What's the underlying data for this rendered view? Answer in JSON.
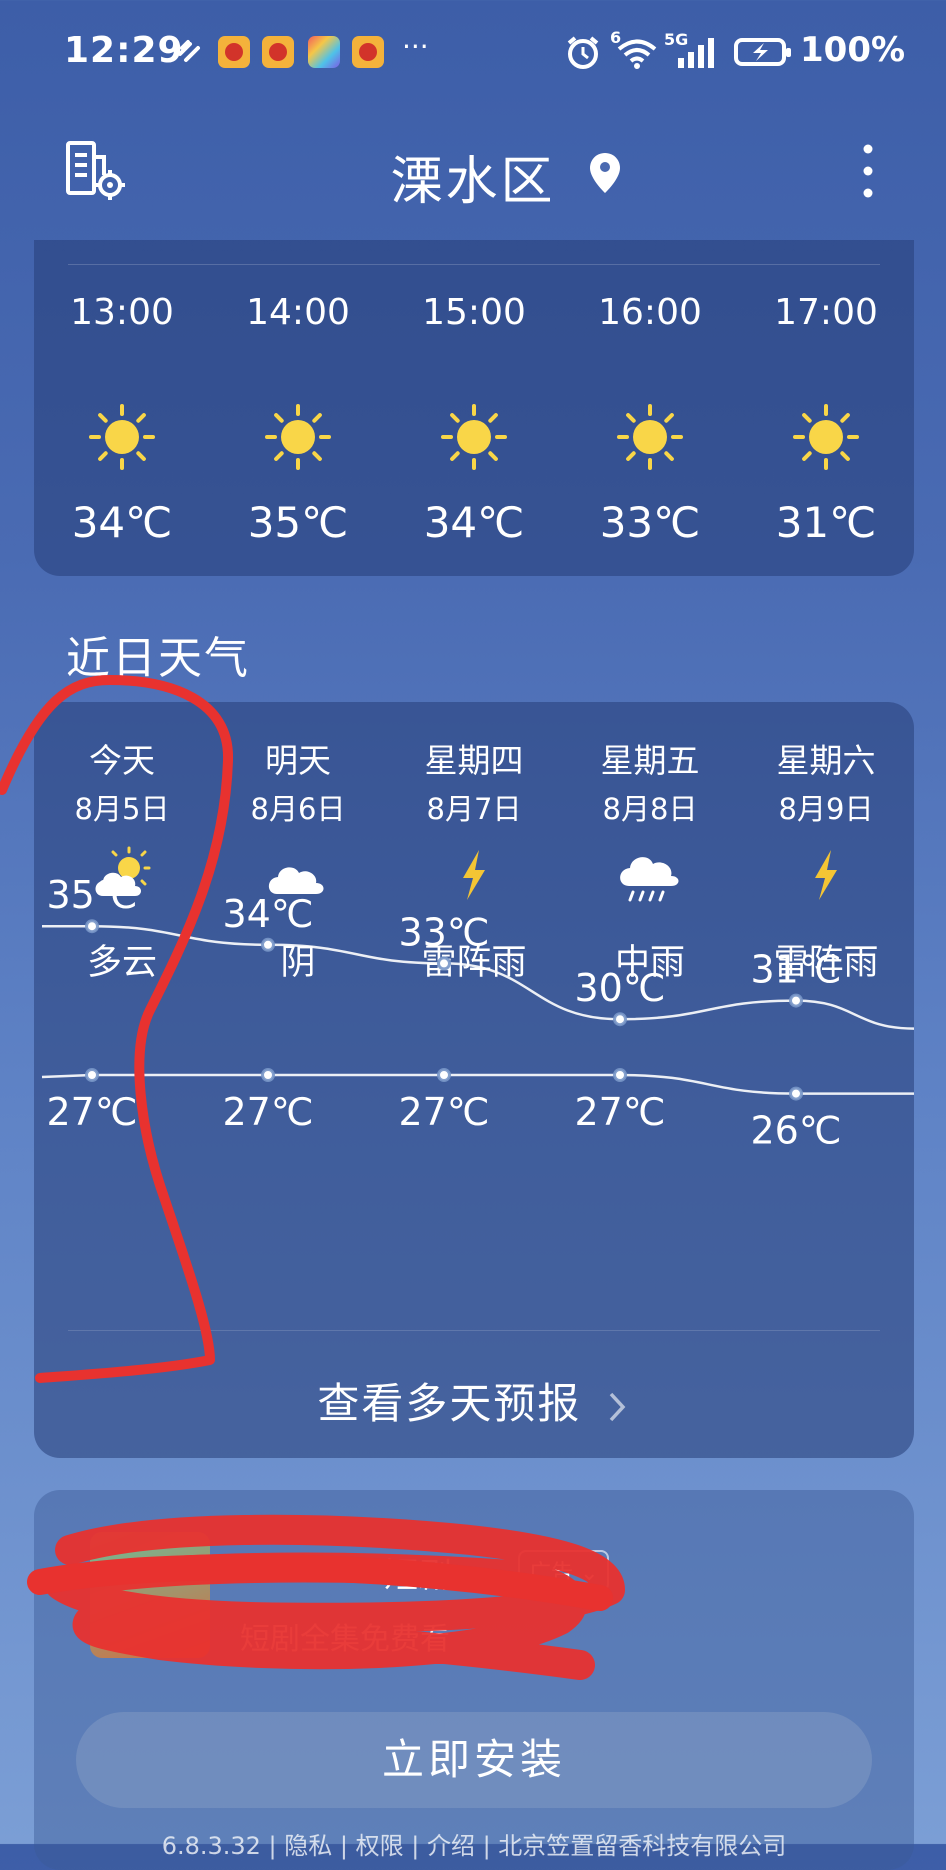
{
  "status_bar": {
    "time": "12:29",
    "more": "···",
    "network_badge": "6",
    "signal_badge": "5G",
    "battery": "100%",
    "app_icons": [
      "weibo-icon",
      "weibo-icon",
      "app-icon",
      "weibo-icon"
    ]
  },
  "header": {
    "title": "溧水区",
    "left_icon": "city-manage-icon",
    "location_icon": "location-pin-icon",
    "menu_icon": "more-vertical-icon"
  },
  "hourly": [
    {
      "time": "13:00",
      "icon": "sun-icon",
      "temp": "34℃"
    },
    {
      "time": "14:00",
      "icon": "sun-icon",
      "temp": "35℃"
    },
    {
      "time": "15:00",
      "icon": "sun-icon",
      "temp": "34℃"
    },
    {
      "time": "16:00",
      "icon": "sun-icon",
      "temp": "33℃"
    },
    {
      "time": "17:00",
      "icon": "sun-icon",
      "temp": "31℃"
    }
  ],
  "daily": {
    "title": "近日天气",
    "days": [
      {
        "day": "今天",
        "date": "8月5日",
        "icon": "partly-cloudy-icon",
        "cond": "多云",
        "high": 35,
        "low": 27,
        "high_label": "35℃",
        "low_label": "27℃"
      },
      {
        "day": "明天",
        "date": "8月6日",
        "icon": "cloud-icon",
        "cond": "阴",
        "high": 34,
        "low": 27,
        "high_label": "34℃",
        "low_label": "27℃"
      },
      {
        "day": "星期四",
        "date": "8月7日",
        "icon": "lightning-icon",
        "cond": "雷阵雨",
        "high": 33,
        "low": 27,
        "high_label": "33℃",
        "low_label": "27℃"
      },
      {
        "day": "星期五",
        "date": "8月8日",
        "icon": "rain-cloud-icon",
        "cond": "中雨",
        "high": 30,
        "low": 27,
        "high_label": "30℃",
        "low_label": "27℃"
      },
      {
        "day": "星期六",
        "date": "8月9日",
        "icon": "lightning-icon",
        "cond": "雷阵雨",
        "high": 31,
        "low": 26,
        "high_label": "31℃",
        "low_label": "26℃"
      }
    ],
    "more_label": "查看多天预报",
    "more_icon": "chevron-right-icon"
  },
  "ad": {
    "title": "短剧",
    "tag": "广告",
    "subtitle": "短剧全集免费看",
    "install_label": "立即安装",
    "footer": "6.8.3.32 | 隐私 | 权限 | 介绍 | 北京笠置留香科技有限公司"
  },
  "colors": {
    "annotation": "#e8322f",
    "sun": "#f9d648"
  }
}
